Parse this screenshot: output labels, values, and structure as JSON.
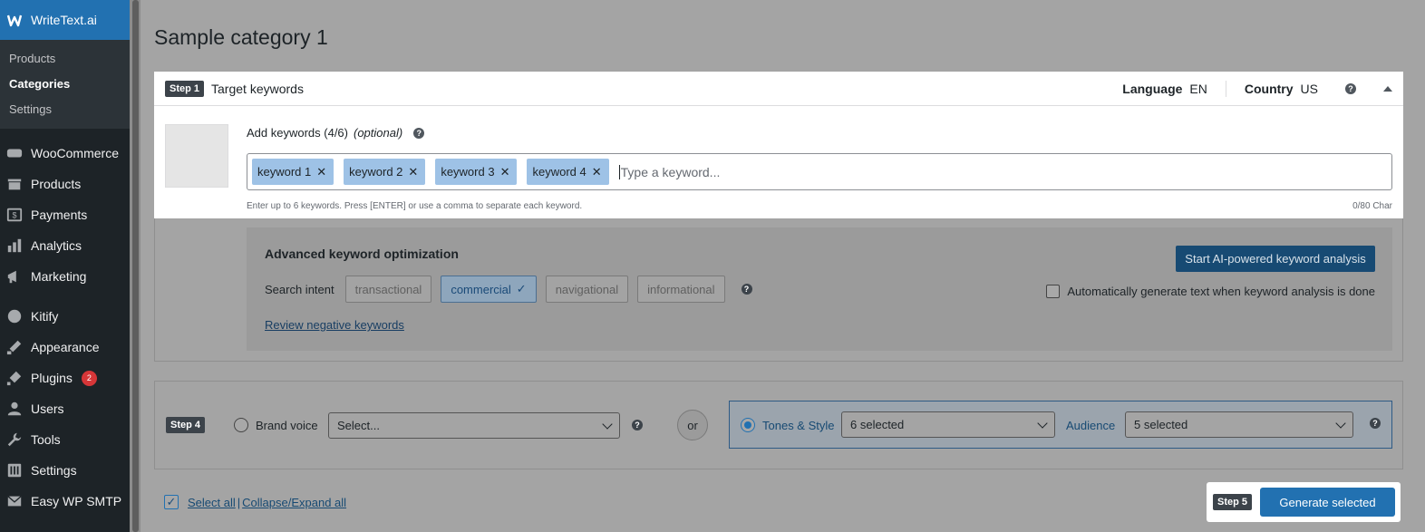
{
  "sidebar": {
    "brand": "WriteText.ai",
    "submenu": [
      {
        "label": "Products",
        "active": false
      },
      {
        "label": "Categories",
        "active": true
      },
      {
        "label": "Settings",
        "active": false
      }
    ],
    "menu": [
      {
        "label": "WooCommerce",
        "icon": "woocommerce-icon"
      },
      {
        "label": "Products",
        "icon": "products-icon"
      },
      {
        "label": "Payments",
        "icon": "payments-icon"
      },
      {
        "label": "Analytics",
        "icon": "analytics-icon"
      },
      {
        "label": "Marketing",
        "icon": "marketing-icon"
      },
      {
        "label": "Kitify",
        "icon": "kitify-icon"
      },
      {
        "label": "Appearance",
        "icon": "appearance-icon"
      },
      {
        "label": "Plugins",
        "icon": "plugins-icon",
        "badge": "2"
      },
      {
        "label": "Users",
        "icon": "users-icon"
      },
      {
        "label": "Tools",
        "icon": "tools-icon"
      },
      {
        "label": "Settings",
        "icon": "settings-icon"
      },
      {
        "label": "Easy WP SMTP",
        "icon": "mail-icon"
      }
    ]
  },
  "page": {
    "title": "Sample category 1"
  },
  "step1": {
    "badge": "Step 1",
    "title": "Target keywords",
    "language_label": "Language",
    "language_value": "EN",
    "country_label": "Country",
    "country_value": "US",
    "add_keywords_label": "Add keywords (4/6)",
    "optional_label": "(optional)",
    "keywords": [
      "keyword 1",
      "keyword 2",
      "keyword 3",
      "keyword 4"
    ],
    "placeholder": "Type a keyword...",
    "hint": "Enter up to 6 keywords. Press [ENTER] or use a comma to separate each keyword.",
    "char_count": "0/80 Char"
  },
  "advanced": {
    "title": "Advanced keyword optimization",
    "analysis_button": "Start AI-powered keyword analysis",
    "search_intent_label": "Search intent",
    "intents": [
      {
        "label": "transactional",
        "selected": false
      },
      {
        "label": "commercial",
        "selected": true
      },
      {
        "label": "navigational",
        "selected": false
      },
      {
        "label": "informational",
        "selected": false
      }
    ],
    "auto_generate_label": "Automatically generate text when keyword analysis is done",
    "negative_link": "Review negative keywords"
  },
  "step4": {
    "badge": "Step 4",
    "brand_voice_label": "Brand voice",
    "brand_voice_select": "Select...",
    "or_label": "or",
    "tones_label": "Tones & Style",
    "tones_select": "6 selected",
    "audience_label": "Audience",
    "audience_select": "5 selected"
  },
  "footer": {
    "select_all": "Select all",
    "collapse_expand": "Collapse/Expand all",
    "step5_badge": "Step 5",
    "generate_button": "Generate selected"
  },
  "colors": {
    "accent": "#2271b1",
    "sidebar": "#1d2327",
    "chip": "#9ec2e6"
  }
}
